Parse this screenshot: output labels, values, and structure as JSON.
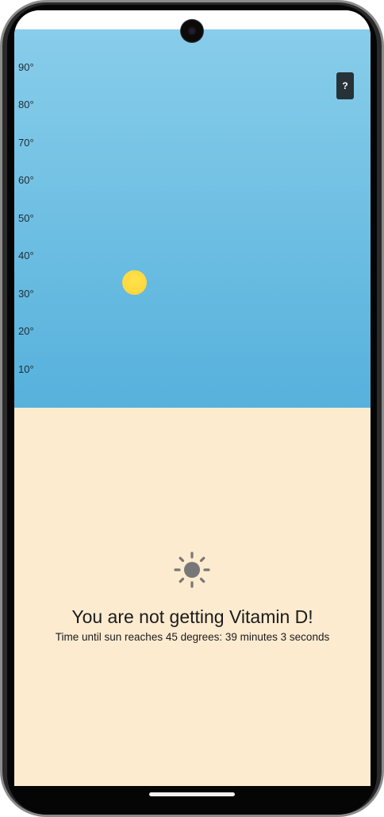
{
  "sky": {
    "degree_labels": [
      "90°",
      "80°",
      "70°",
      "60°",
      "50°",
      "40°",
      "30°",
      "20°",
      "10°"
    ],
    "sun_altitude_deg": 36
  },
  "help_button": {
    "label": "?"
  },
  "status": {
    "icon": "sun-icon",
    "message": "You are not getting Vitamin D!",
    "detail": "Time until sun reaches 45 degrees: 39 minutes 3 seconds"
  },
  "colors": {
    "sky_top": "#88cdea",
    "sky_bottom": "#56b1dc",
    "ground": "#fdebd0",
    "sun": "#fdd835",
    "help_button_bg": "#263238",
    "icon_gray": "#777777"
  }
}
